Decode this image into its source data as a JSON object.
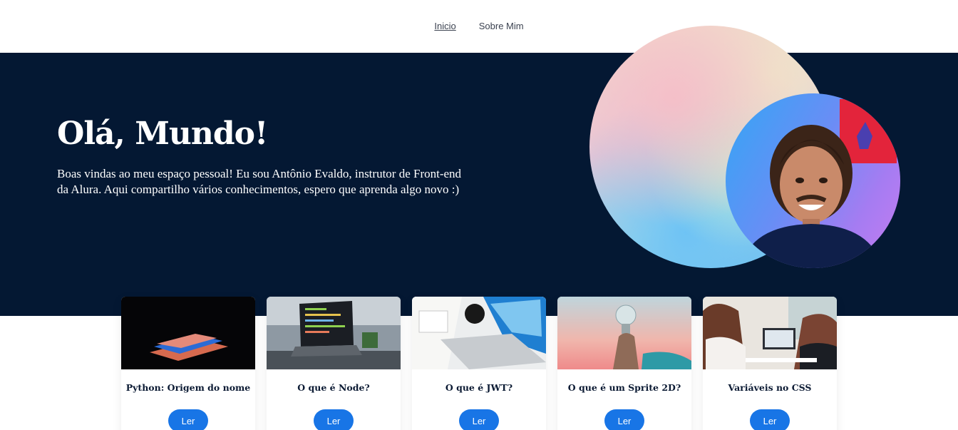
{
  "nav": {
    "items": [
      {
        "label": "Inicio"
      },
      {
        "label": "Sobre Mim"
      }
    ]
  },
  "hero": {
    "title": "Olá, Mundo!",
    "text": "Boas vindas ao meu espaço pessoal! Eu sou Antônio Evaldo, instrutor de Front-end da Alura. Aqui compartilho vários conhecimentos, espero que aprenda algo novo :)"
  },
  "colors": {
    "hero_bg": "#041833",
    "button_bg": "#1875e6",
    "card_title": "#0b1a33"
  },
  "cards": [
    {
      "title": "Python: Origem do nome",
      "button": "Ler",
      "image": "laptop-dark-image"
    },
    {
      "title": "O que é Node?",
      "button": "Ler",
      "image": "code-laptop-image"
    },
    {
      "title": "O que é JWT?",
      "button": "Ler",
      "image": "desk-laptop-image"
    },
    {
      "title": "O que é um Sprite 2D?",
      "button": "Ler",
      "image": "lightbulb-image"
    },
    {
      "title": "Variáveis no CSS",
      "button": "Ler",
      "image": "people-laptop-image"
    }
  ]
}
